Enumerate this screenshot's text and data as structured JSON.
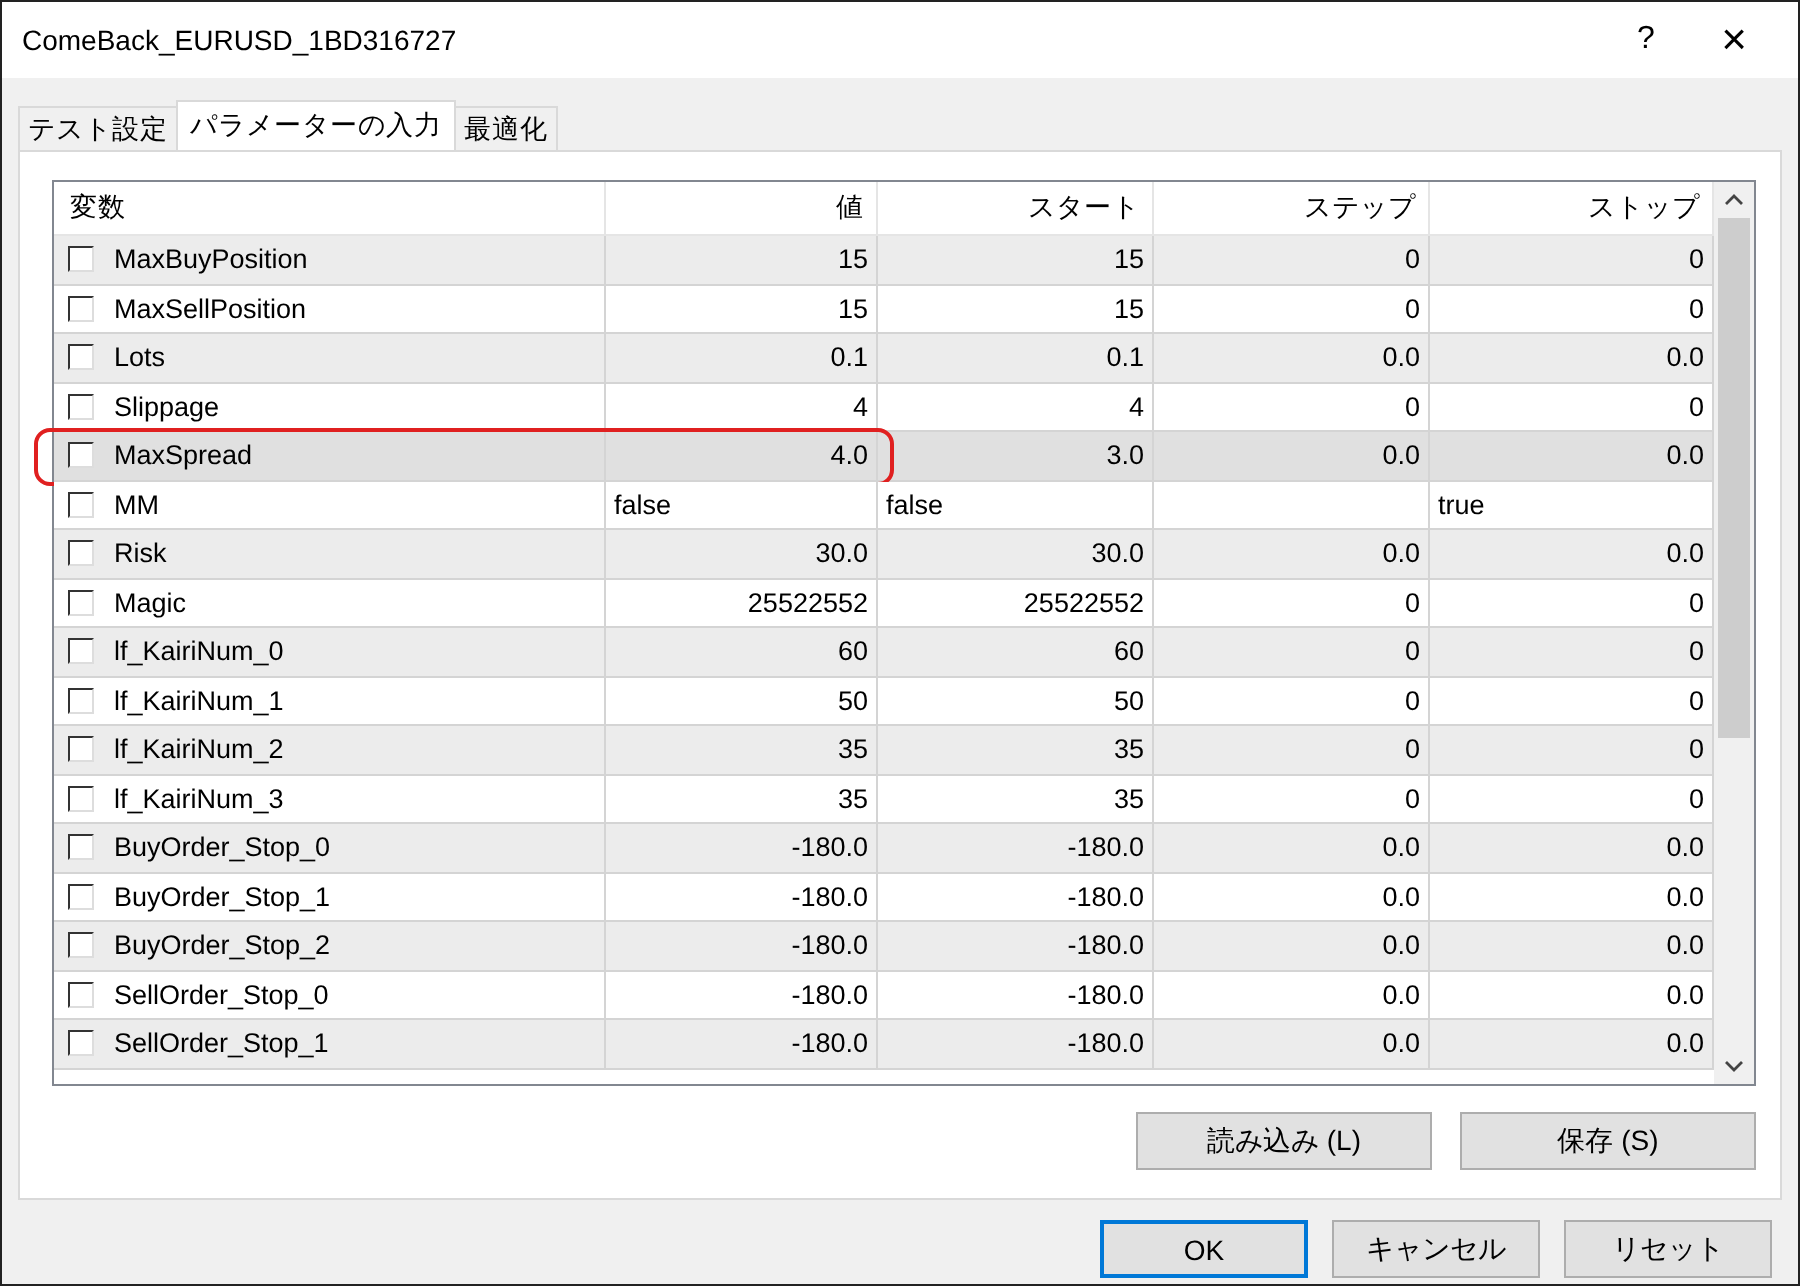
{
  "window": {
    "title": "ComeBack_EURUSD_1BD316727",
    "help": "?",
    "close": "×"
  },
  "tabs": [
    {
      "label": "テスト設定",
      "selected": false
    },
    {
      "label": "パラメーターの入力",
      "selected": true
    },
    {
      "label": "最適化",
      "selected": false
    }
  ],
  "table": {
    "columns": [
      "変数",
      "値",
      "スタート",
      "ステップ",
      "ストップ"
    ],
    "rows": [
      {
        "checked": false,
        "selected": false,
        "highlighted": false,
        "cells": [
          "MaxBuyPosition",
          "15",
          "15",
          "0",
          "0"
        ]
      },
      {
        "checked": false,
        "selected": false,
        "highlighted": false,
        "cells": [
          "MaxSellPosition",
          "15",
          "15",
          "0",
          "0"
        ]
      },
      {
        "checked": false,
        "selected": false,
        "highlighted": false,
        "cells": [
          "Lots",
          "0.1",
          "0.1",
          "0.0",
          "0.0"
        ]
      },
      {
        "checked": false,
        "selected": false,
        "highlighted": false,
        "cells": [
          "Slippage",
          "4",
          "4",
          "0",
          "0"
        ]
      },
      {
        "checked": false,
        "selected": true,
        "highlighted": true,
        "cells": [
          "MaxSpread",
          "4.0",
          "3.0",
          "0.0",
          "0.0"
        ]
      },
      {
        "checked": false,
        "selected": false,
        "highlighted": false,
        "kind": "bool",
        "cells": [
          "MM",
          "false",
          "false",
          "",
          "true"
        ]
      },
      {
        "checked": false,
        "selected": false,
        "highlighted": false,
        "cells": [
          "Risk",
          "30.0",
          "30.0",
          "0.0",
          "0.0"
        ]
      },
      {
        "checked": false,
        "selected": false,
        "highlighted": false,
        "cells": [
          "Magic",
          "25522552",
          "25522552",
          "0",
          "0"
        ]
      },
      {
        "checked": false,
        "selected": false,
        "highlighted": false,
        "cells": [
          "lf_KairiNum_0",
          "60",
          "60",
          "0",
          "0"
        ]
      },
      {
        "checked": false,
        "selected": false,
        "highlighted": false,
        "cells": [
          "lf_KairiNum_1",
          "50",
          "50",
          "0",
          "0"
        ]
      },
      {
        "checked": false,
        "selected": false,
        "highlighted": false,
        "cells": [
          "lf_KairiNum_2",
          "35",
          "35",
          "0",
          "0"
        ]
      },
      {
        "checked": false,
        "selected": false,
        "highlighted": false,
        "cells": [
          "lf_KairiNum_3",
          "35",
          "35",
          "0",
          "0"
        ]
      },
      {
        "checked": false,
        "selected": false,
        "highlighted": false,
        "cells": [
          "BuyOrder_Stop_0",
          "-180.0",
          "-180.0",
          "0.0",
          "0.0"
        ]
      },
      {
        "checked": false,
        "selected": false,
        "highlighted": false,
        "cells": [
          "BuyOrder_Stop_1",
          "-180.0",
          "-180.0",
          "0.0",
          "0.0"
        ]
      },
      {
        "checked": false,
        "selected": false,
        "highlighted": false,
        "cells": [
          "BuyOrder_Stop_2",
          "-180.0",
          "-180.0",
          "0.0",
          "0.0"
        ]
      },
      {
        "checked": false,
        "selected": false,
        "highlighted": false,
        "cells": [
          "SellOrder_Stop_0",
          "-180.0",
          "-180.0",
          "0.0",
          "0.0"
        ]
      },
      {
        "checked": false,
        "selected": false,
        "highlighted": false,
        "cells": [
          "SellOrder_Stop_1",
          "-180.0",
          "-180.0",
          "0.0",
          "0.0"
        ]
      }
    ]
  },
  "file_buttons": [
    {
      "label": "読み込み (L)"
    },
    {
      "label": "保存 (S)"
    }
  ],
  "buttons": [
    {
      "label": "OK",
      "default": true
    },
    {
      "label": "キャンセル",
      "default": false
    },
    {
      "label": "リセット",
      "default": false
    }
  ]
}
